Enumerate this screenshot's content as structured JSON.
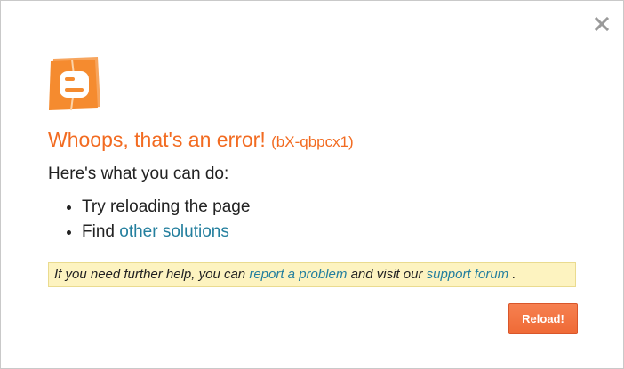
{
  "dialog": {
    "close_icon": "close-icon",
    "logo_icon": "blogger-logo-icon",
    "title": "Whoops, that's an error!",
    "error_code": "(bX-qbpcx1)",
    "subtitle": "Here's what you can do:",
    "options": {
      "reload": "Try reloading the page",
      "find_prefix": "Find",
      "find_link": "other solutions"
    },
    "help": {
      "text_1": "If you need further help, you can",
      "report_link": "report a problem",
      "text_2": "and visit our",
      "forum_link": "support forum",
      "text_3": "."
    },
    "reload_button": "Reload!",
    "colors": {
      "accent": "#f26b21",
      "link": "#247f9e",
      "help_bg": "#fdf3c0",
      "button": "#f47942"
    }
  }
}
